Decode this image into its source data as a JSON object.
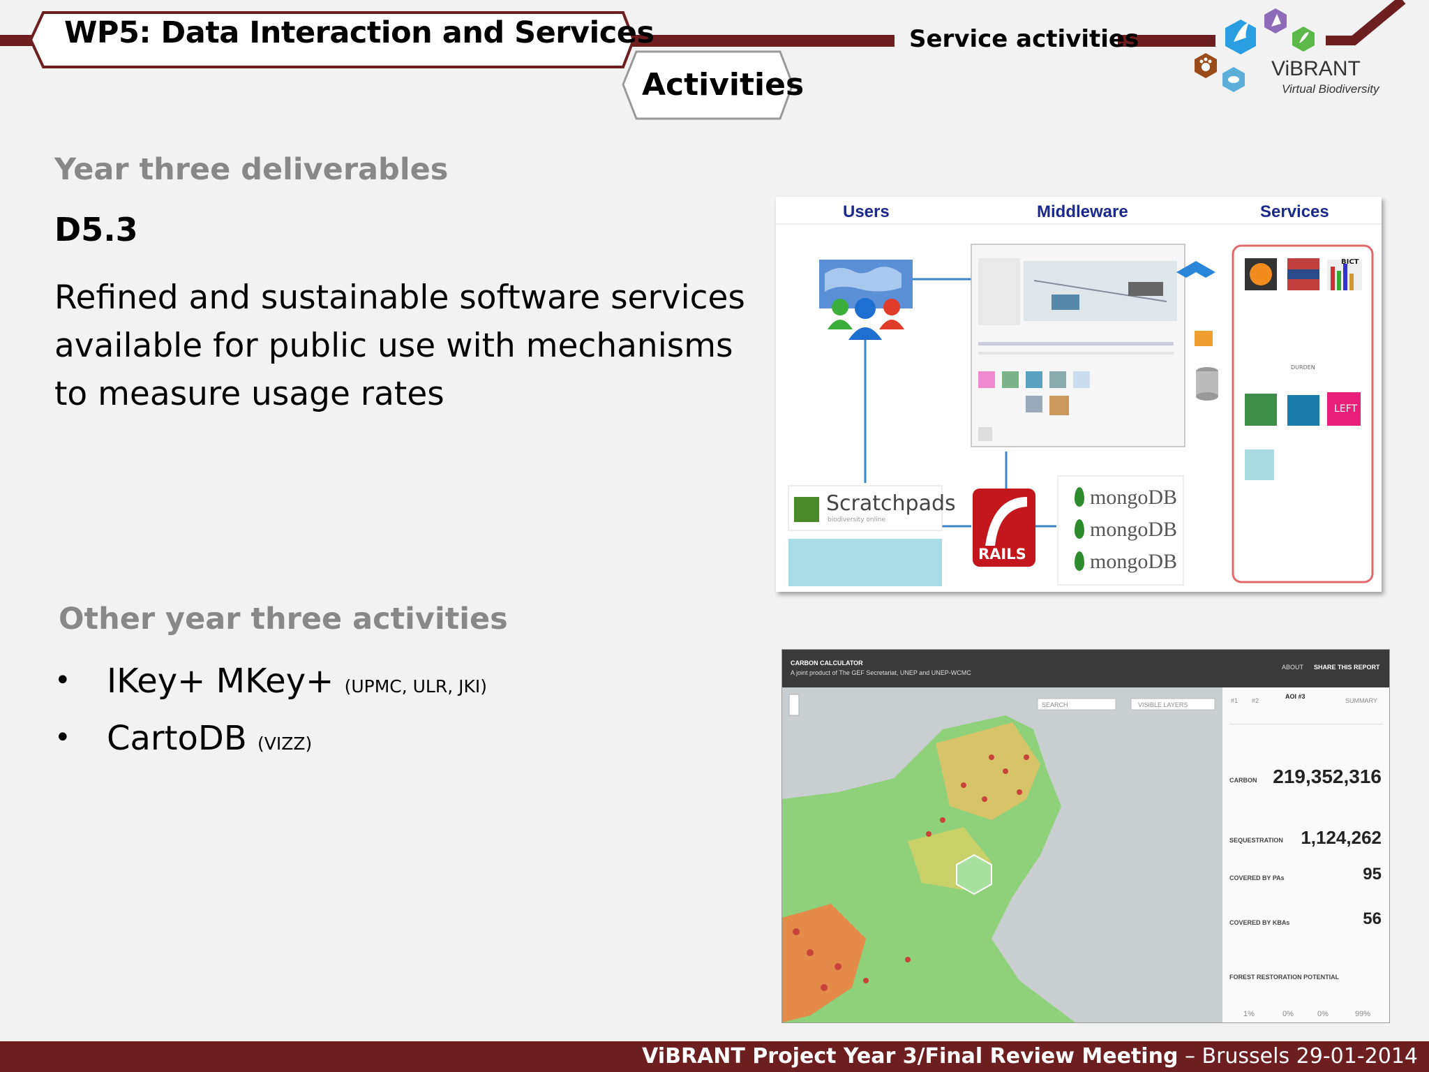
{
  "header": {
    "title": "WP5: Data Interaction and Services",
    "subtitle_tab": "Activities",
    "section": "Service activities",
    "brand_color": "#6d1f20"
  },
  "logo": {
    "name": "ViBRANT",
    "tagline": "Virtual Biodiversity"
  },
  "deliverables": {
    "heading": "Year three deliverables",
    "id": "D5.3",
    "description": "Refined and sustainable software services available for public use with mechanisms to measure usage rates"
  },
  "other": {
    "heading": "Other year three activities",
    "items": [
      {
        "bullet": "•",
        "main": "IKey+  MKey+ ",
        "small": "(UPMC, ULR, JKI)"
      },
      {
        "bullet": "•",
        "main": "CartoDB ",
        "small": "(VIZZ)"
      }
    ]
  },
  "architecture": {
    "columns": [
      "Users",
      "Middleware",
      "Services"
    ],
    "scratchpads": "Scratchpads",
    "scratchpads_sub": "biodiversity online",
    "rails": "RAILS",
    "databases": [
      "mongoDB",
      "mongoDB",
      "mongoDB"
    ],
    "service_tiles": [
      "BICT",
      "LEFT",
      "DURDEN"
    ]
  },
  "carbon_calculator": {
    "app_title": "CARBON CALCULATOR",
    "app_subtitle": "A joint product of The GEF Secretariat, UNEP and UNEP-WCMC",
    "nav": [
      "ABOUT",
      "SHARE THIS REPORT"
    ],
    "search_placeholder": "SEARCH",
    "layers_label": "VISIBLE LAYERS",
    "tabs": [
      "#1",
      "#2",
      "AOI #3",
      "SUMMARY"
    ],
    "carbon_value": "219,352,316",
    "sequestration_value": "1,124,262",
    "covered_1": "95",
    "covered_2": "56",
    "row_labels": [
      "CARBON",
      "SEQUESTRATION",
      "COVERED BY PAs",
      "COVERED BY KBAs",
      "FOREST RESTORATION POTENTIAL"
    ],
    "restoration_values": [
      "1%",
      "0%",
      "0%",
      "99%"
    ]
  },
  "footer": {
    "meeting": "ViBRANT Project Year 3/Final Review Meeting",
    "location_date": " – Brussels 29-01-2014"
  }
}
